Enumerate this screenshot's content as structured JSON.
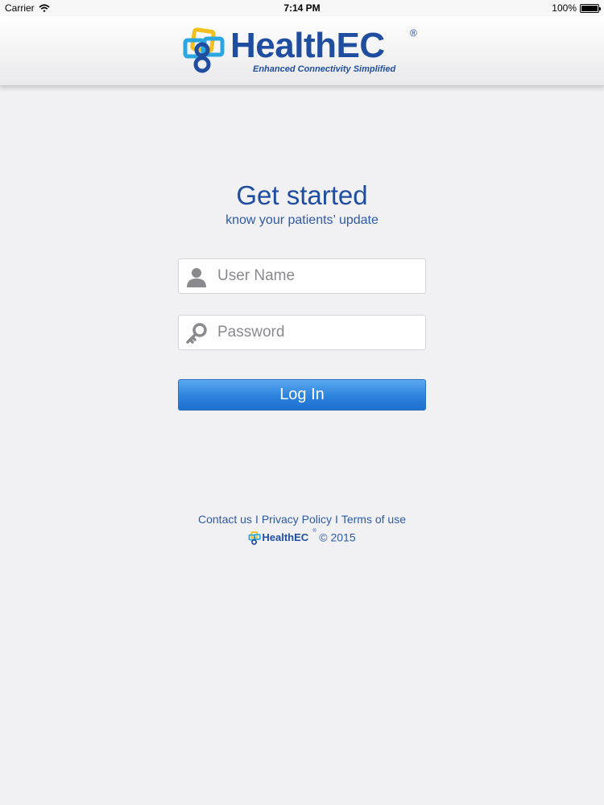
{
  "status_bar": {
    "carrier": "Carrier",
    "time": "7:14 PM",
    "battery": "100%"
  },
  "header": {
    "brand": "HealthEC",
    "registered": "®",
    "tagline": "Enhanced Connectivity Simplified"
  },
  "main": {
    "title": "Get started",
    "subtitle": "know your patients’ update"
  },
  "form": {
    "username_placeholder": "User Name",
    "username_value": "",
    "password_placeholder": "Password",
    "password_value": "",
    "login_label": "Log In"
  },
  "footer": {
    "contact": "Contact us",
    "privacy": "Privacy Policy",
    "terms": "Terms of use",
    "separator": "I",
    "brand": "HealthEC",
    "registered": "®",
    "copyright": "© 2015"
  },
  "icons": {
    "user": "user-icon",
    "password": "key-icon",
    "wifi": "wifi-icon",
    "battery": "battery-icon"
  },
  "colors": {
    "brand_blue": "#1f4ea1",
    "button_blue": "#2c82dc",
    "logo_yellow": "#f2c01a",
    "logo_cyan": "#2aa7e0"
  }
}
